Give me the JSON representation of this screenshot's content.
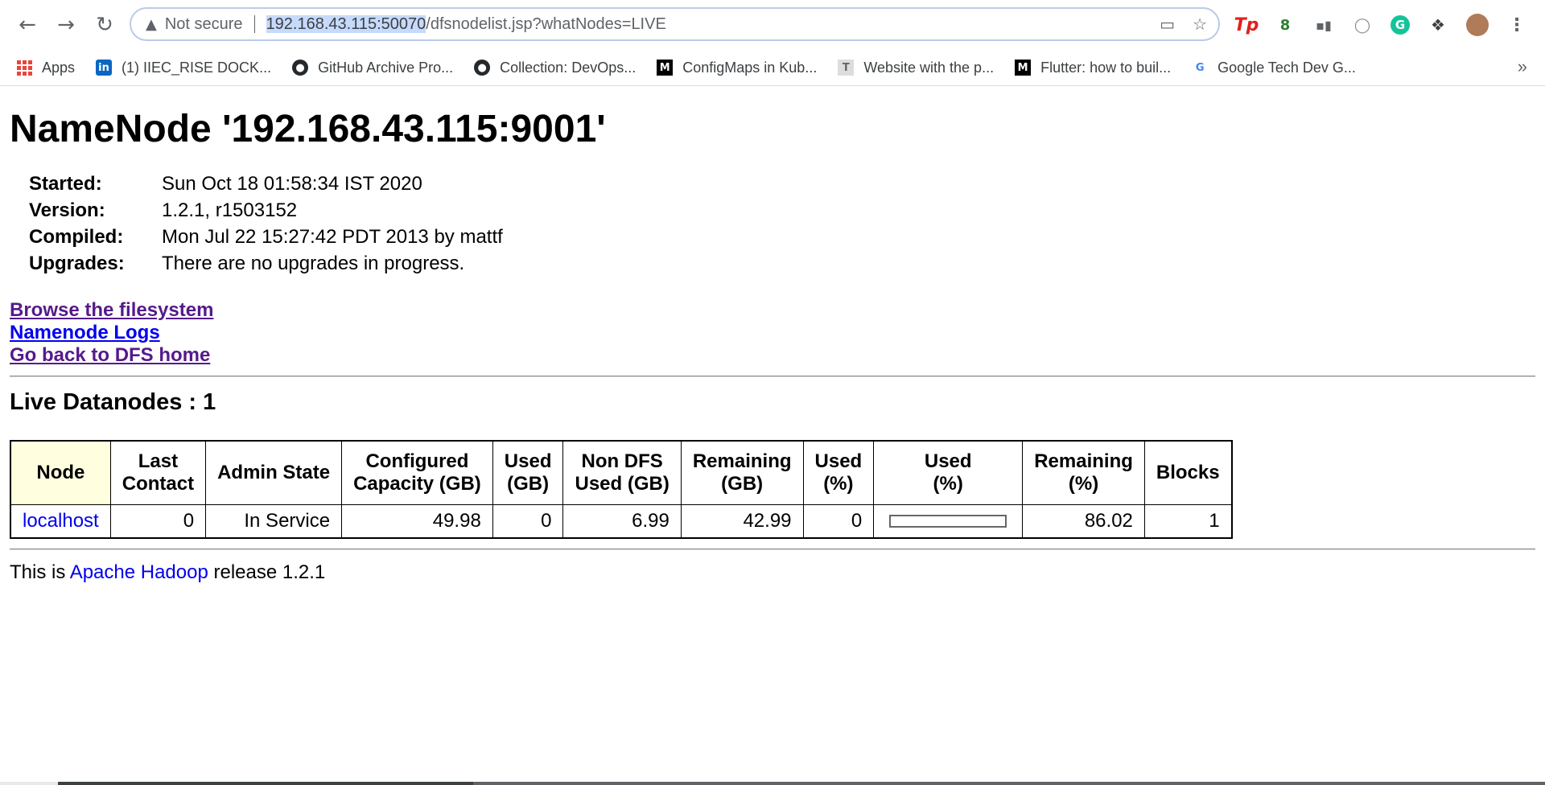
{
  "browser": {
    "security_label": "Not secure",
    "url_host": "192.168.43.115:50070",
    "url_path": "/dfsnodelist.jsp?whatNodes=LIVE",
    "bookmarks": [
      {
        "label": "Apps",
        "icon": "apps-grid-icon"
      },
      {
        "label": "(1) IIEC_RISE DOCK...",
        "icon": "linkedin-icon"
      },
      {
        "label": "GitHub Archive Pro...",
        "icon": "github-icon"
      },
      {
        "label": "Collection: DevOps...",
        "icon": "github-icon"
      },
      {
        "label": "ConfigMaps in Kub...",
        "icon": "medium-icon"
      },
      {
        "label": "Website with the p...",
        "icon": "site-icon"
      },
      {
        "label": "Flutter: how to buil...",
        "icon": "medium-icon"
      },
      {
        "label": "Google Tech Dev G...",
        "icon": "google-icon"
      }
    ],
    "bookmarks_more": "»"
  },
  "page": {
    "title": "NameNode '192.168.43.115:9001'",
    "info": [
      {
        "key": "Started:",
        "value": "Sun Oct 18 01:58:34 IST 2020"
      },
      {
        "key": "Version:",
        "value": "1.2.1, r1503152"
      },
      {
        "key": "Compiled:",
        "value": "Mon Jul 22 15:27:42 PDT 2013 by mattf"
      },
      {
        "key": "Upgrades:",
        "value": "There are no upgrades in progress."
      }
    ],
    "links": [
      {
        "label": "Browse the filesystem"
      },
      {
        "label": "Namenode Logs"
      },
      {
        "label": "Go back to DFS home"
      }
    ],
    "section_title": "Live Datanodes : 1",
    "table": {
      "headers": [
        [
          "Node"
        ],
        [
          "Last",
          "Contact"
        ],
        [
          "Admin State"
        ],
        [
          "Configured",
          "Capacity (GB)"
        ],
        [
          "Used",
          "(GB)"
        ],
        [
          "Non DFS",
          "Used (GB)"
        ],
        [
          "Remaining",
          "(GB)"
        ],
        [
          "Used",
          "(%)"
        ],
        [
          "Used",
          "(%)"
        ],
        [
          "Remaining",
          "(%)"
        ],
        [
          "Blocks"
        ]
      ],
      "row": {
        "node": "localhost",
        "last_contact": "0",
        "admin_state": "In Service",
        "configured_capacity": "49.98",
        "used_gb": "0",
        "non_dfs_used": "6.99",
        "remaining_gb": "42.99",
        "used_pct": "0",
        "used_pct_bar_fraction": 0.0,
        "remaining_pct": "86.02",
        "blocks": "1"
      }
    },
    "footer": {
      "prefix": "This is ",
      "link": "Apache Hadoop",
      "suffix": " release 1.2.1"
    }
  }
}
